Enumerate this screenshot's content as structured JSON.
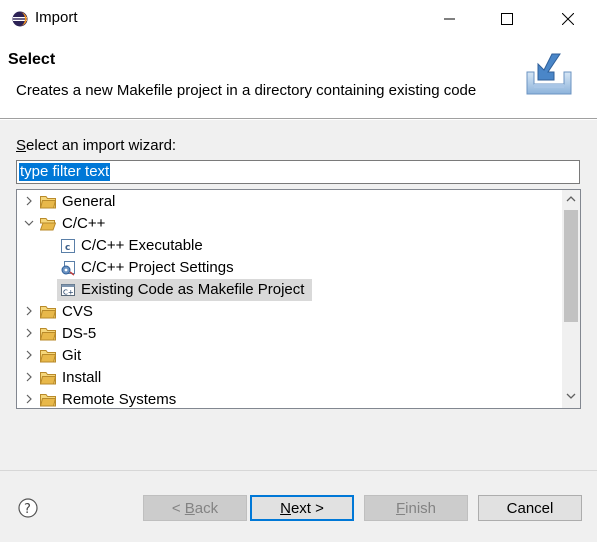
{
  "window": {
    "title": "Import",
    "minimize_icon": "minimize-icon",
    "maximize_icon": "maximize-icon",
    "close_icon": "close-icon"
  },
  "banner": {
    "title": "Select",
    "description": "Creates a new Makefile project in a directory containing existing code",
    "icon": "import-wizard-icon"
  },
  "wizard": {
    "label_first": "S",
    "label_rest": "elect an import wizard:",
    "filter_value": "type filter text"
  },
  "tree": {
    "items": [
      {
        "label": "General",
        "type": "folder",
        "expanded": false
      },
      {
        "label": "C/C++",
        "type": "folder",
        "expanded": true
      },
      {
        "label": "C/C++ Executable",
        "type": "file",
        "icon": "c-executable-icon"
      },
      {
        "label": "C/C++ Project Settings",
        "type": "file",
        "icon": "project-settings-icon"
      },
      {
        "label": "Existing Code as Makefile Project",
        "type": "file",
        "icon": "makefile-project-icon",
        "selected": true
      },
      {
        "label": "CVS",
        "type": "folder",
        "expanded": false
      },
      {
        "label": "DS-5",
        "type": "folder",
        "expanded": false
      },
      {
        "label": "Git",
        "type": "folder",
        "expanded": false
      },
      {
        "label": "Install",
        "type": "folder",
        "expanded": false
      },
      {
        "label": "Remote Systems",
        "type": "folder",
        "expanded": false
      }
    ]
  },
  "buttons": {
    "back_prefix": "< ",
    "back_u": "B",
    "back_rest": "ack",
    "next_u": "N",
    "next_rest": "ext >",
    "finish_u": "F",
    "finish_rest": "inish",
    "cancel": "Cancel"
  },
  "colors": {
    "selection": "#0078d7",
    "tree_selected": "#d9d9d9",
    "folder": "#e8b84a"
  }
}
